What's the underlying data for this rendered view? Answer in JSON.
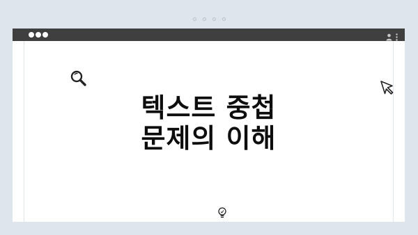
{
  "headline": {
    "line1": "텍스트 중첩",
    "line2": "문제의 이해"
  },
  "carousel": {
    "dot_count": 4
  },
  "icons": {
    "search": "search-icon",
    "cursor": "cursor-icon",
    "lightbulb": "lightbulb-icon",
    "profile": "profile-icon",
    "menu": "more-vertical-icon"
  },
  "colors": {
    "background": "#dfe5ec",
    "titlebar": "#3f3f3f",
    "window": "#ffffff",
    "text": "#0d0d0d"
  }
}
